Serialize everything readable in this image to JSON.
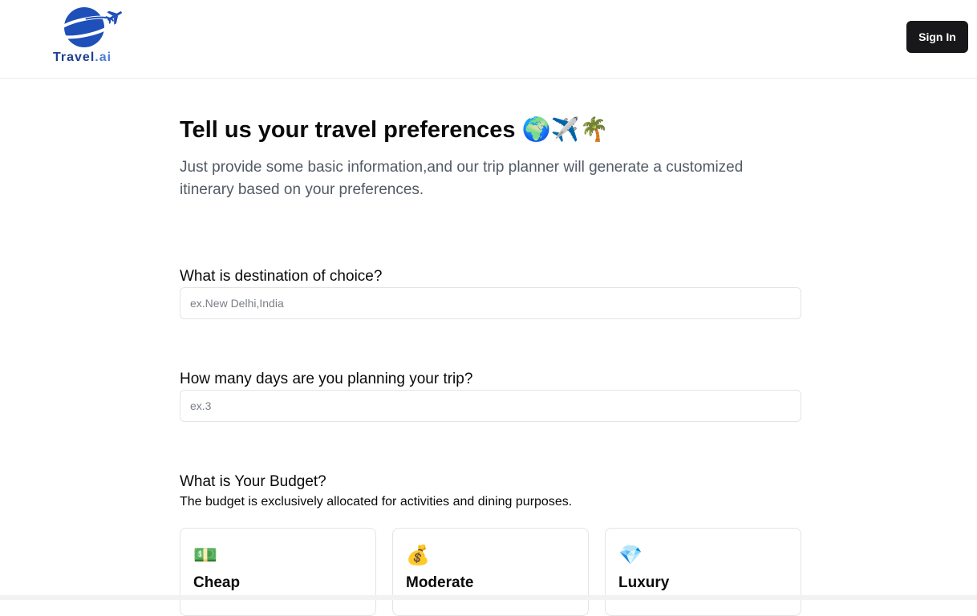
{
  "header": {
    "logo_text": "Travel",
    "logo_suffix": ".ai",
    "sign_in_label": "Sign In"
  },
  "hero": {
    "title": "Tell us your travel preferences 🌍✈️🌴",
    "subtitle": "Just provide some basic information,and our trip planner will generate a customized itinerary based on your preferences."
  },
  "form": {
    "destination": {
      "label": "What is destination of choice?",
      "placeholder": "ex.New Delhi,India",
      "value": ""
    },
    "days": {
      "label": "How many days are you planning your trip?",
      "placeholder": "ex.3",
      "value": ""
    },
    "budget": {
      "label": "What is Your Budget?",
      "note": "The budget is exclusively allocated for activities and dining purposes.",
      "options": [
        {
          "icon": "💵",
          "icon_name": "cash-icon",
          "title": "Cheap"
        },
        {
          "icon": "💰",
          "icon_name": "money-bag-icon",
          "title": "Moderate"
        },
        {
          "icon": "💎",
          "icon_name": "diamond-icon",
          "title": "Luxury"
        }
      ]
    }
  },
  "colors": {
    "brand_dark": "#1f3f91",
    "brand_light": "#4a7fd8",
    "button_bg": "#18181b",
    "subtitle_text": "#525a66",
    "border": "#e4e4e7"
  }
}
